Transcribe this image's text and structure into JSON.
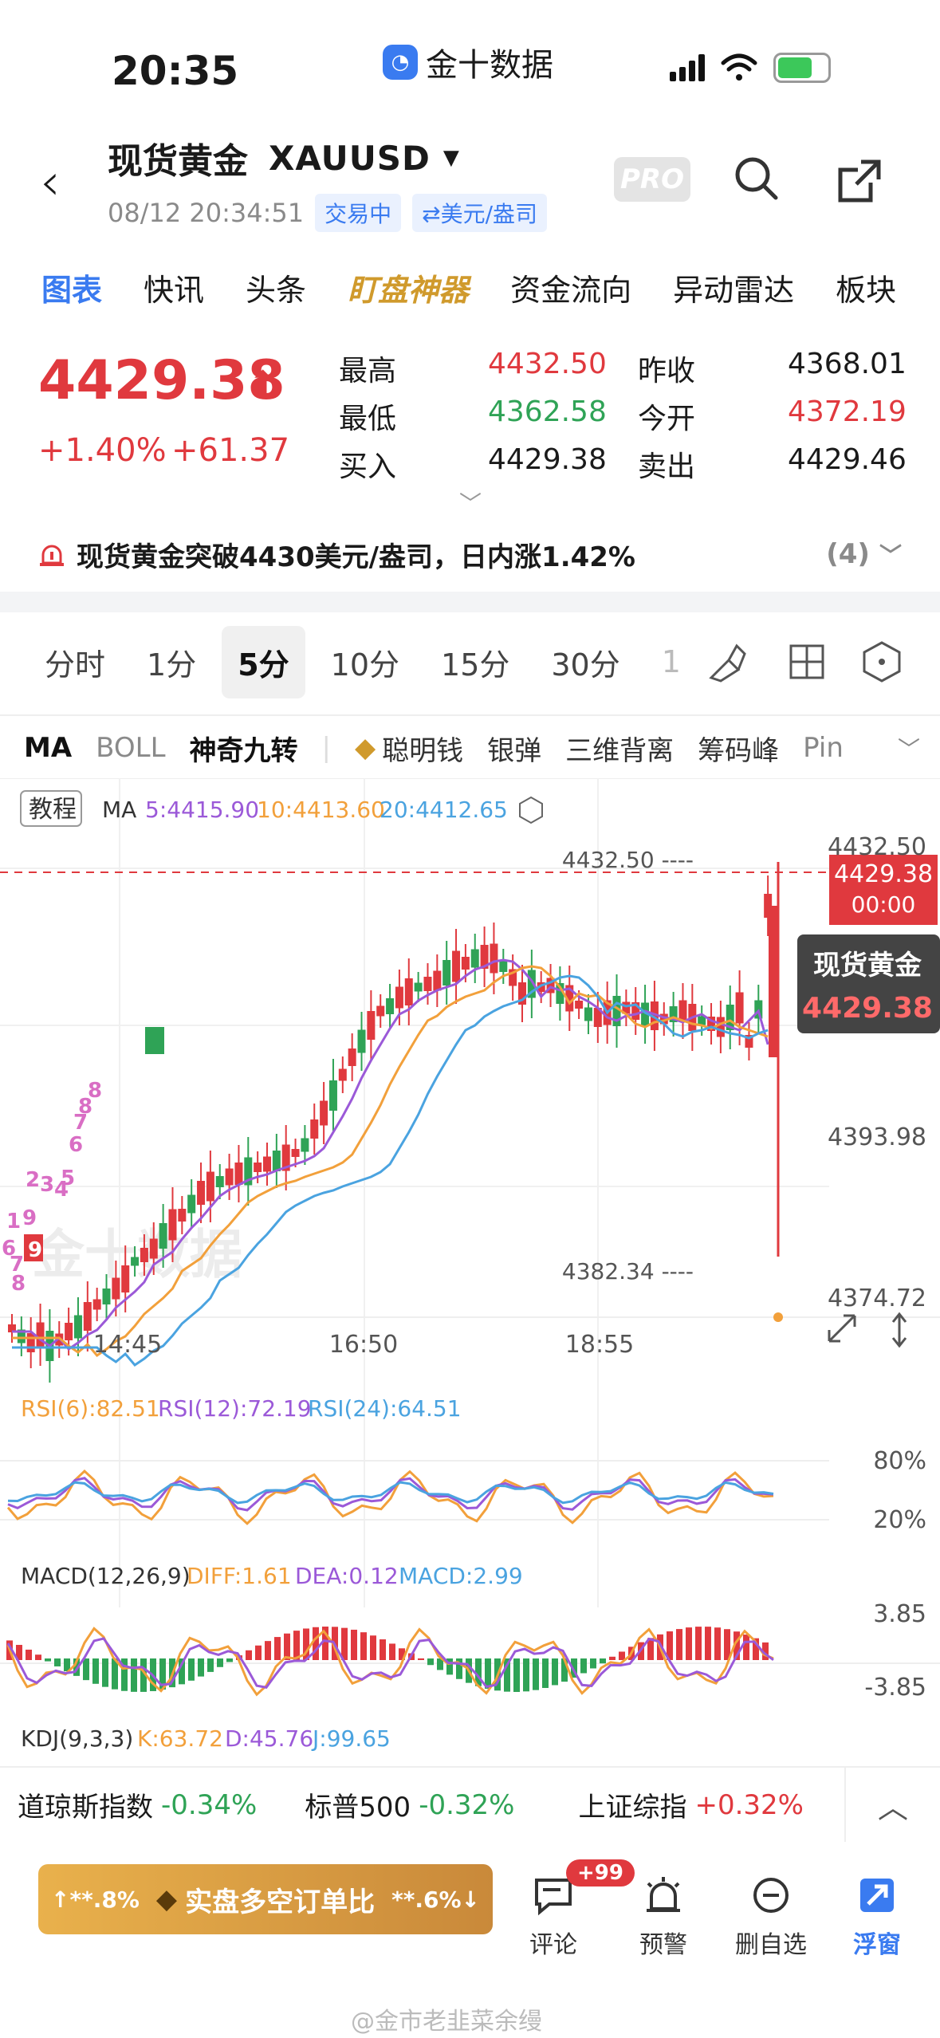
{
  "status": {
    "time": "20:35",
    "app_name": "金十数据"
  },
  "header": {
    "title": "现货黄金",
    "code": "XAUUSD",
    "datetime": "08/12 20:34:51",
    "trade_status": "交易中",
    "unit": "⇄美元/盎司",
    "pro_label": "PRO"
  },
  "main_tabs": [
    "图表",
    "快讯",
    "头条",
    "盯盘神器",
    "资金流向",
    "异动雷达",
    "板块"
  ],
  "quote": {
    "price": "4429.38",
    "change_pct": "+1.40%",
    "change_val": "+61.37",
    "stats": [
      {
        "label": "最高",
        "value": "4432.50",
        "color": "red"
      },
      {
        "label": "昨收",
        "value": "4368.01",
        "color": "black"
      },
      {
        "label": "最低",
        "value": "4362.58",
        "color": "green"
      },
      {
        "label": "今开",
        "value": "4372.19",
        "color": "red"
      },
      {
        "label": "买入",
        "value": "4429.38",
        "color": "black"
      },
      {
        "label": "卖出",
        "value": "4429.46",
        "color": "black"
      }
    ]
  },
  "news": {
    "text": "现货黄金突破4430美元/盎司，日内涨1.42%",
    "count": "(4)"
  },
  "period_tabs": [
    "分时",
    "1分",
    "5分",
    "10分",
    "15分",
    "30分",
    "1"
  ],
  "indicator_tabs": [
    "MA",
    "BOLL",
    "神奇九转",
    "聪明钱",
    "银弹",
    "三维背离",
    "筹码峰",
    "Pin"
  ],
  "chart": {
    "tutorial_label": "教程",
    "ma_label": "MA",
    "ma5": "5:4415.90",
    "ma10": "10:4413.60",
    "ma20": "20:4412.65",
    "y_ticks": [
      "4432.50",
      "4393.98",
      "4374.72"
    ],
    "high_mark": "4432.50",
    "low_mark": "4382.34",
    "current_price": "4429.38",
    "current_countdown": "00:00",
    "tooltip_name": "现货黄金",
    "tooltip_price": "4429.38",
    "watermark": "金十数据",
    "x_ticks": [
      "14:45",
      "16:50",
      "18:55"
    ],
    "td_count_labels": [
      "6",
      "7",
      "8",
      "9",
      "1",
      "2",
      "3",
      "4",
      "5",
      "6",
      "7",
      "8",
      "8"
    ],
    "rsi": {
      "r6": "RSI(6):82.51",
      "r12": "RSI(12):72.19",
      "r24": "RSI(24):64.51",
      "hi": "80%",
      "lo": "20%"
    },
    "macd": {
      "name": "MACD(12,26,9)",
      "diff": "DIFF:1.61",
      "dea": "DEA:0.12",
      "macd": "MACD:2.99",
      "hi": "3.85",
      "lo": "-3.85"
    },
    "kdj": {
      "name": "KDJ(9,3,3)",
      "k": "K:63.72",
      "d": "D:45.76",
      "j": "J:99.65"
    }
  },
  "ticker": [
    {
      "name": "道琼斯指数",
      "value": "-0.34%",
      "color": "green"
    },
    {
      "name": "标普500",
      "value": "-0.32%",
      "color": "green"
    },
    {
      "name": "上证综指",
      "value": "+0.32%",
      "color": "red"
    }
  ],
  "bottom": {
    "left_pct": "↑**.8%",
    "center_label": "实盘多空订单比",
    "right_pct": "**.6%↓",
    "comment_label": "评论",
    "comment_badge": "+99",
    "alert_label": "预警",
    "remove_label": "删自选",
    "float_label": "浮窗",
    "watermark": "@金市老韭菜余缦"
  }
}
